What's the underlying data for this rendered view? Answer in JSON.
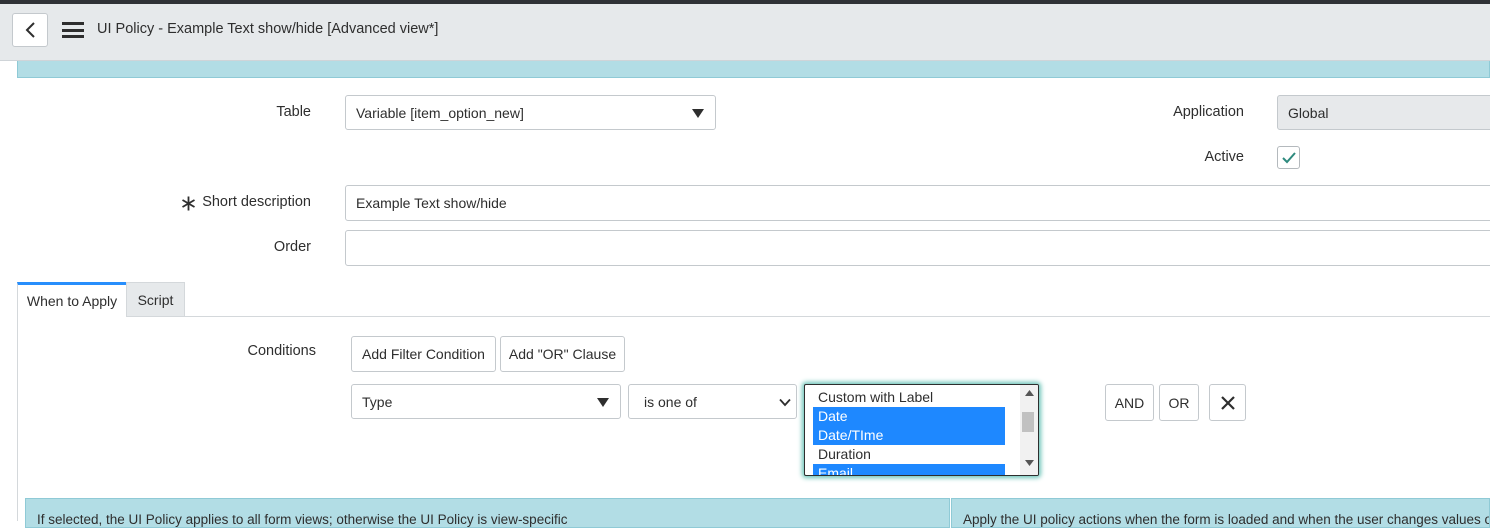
{
  "header": {
    "title": "UI Policy - Example Text show/hide",
    "view": "[Advanced view*]"
  },
  "form": {
    "table": {
      "label": "Table",
      "value": "Variable [item_option_new]"
    },
    "application": {
      "label": "Application",
      "value": "Global"
    },
    "active": {
      "label": "Active",
      "checked": true
    },
    "short_description": {
      "label": "Short description",
      "value": "Example Text show/hide",
      "required": true
    },
    "order": {
      "label": "Order",
      "value": ""
    }
  },
  "tabs": [
    {
      "label": "When to Apply",
      "active": true
    },
    {
      "label": "Script",
      "active": false
    }
  ],
  "conditions": {
    "label": "Conditions",
    "add_filter_label": "Add Filter Condition",
    "add_or_label": "Add \"OR\" Clause",
    "field_value": "Type",
    "operator_value": "is one of",
    "options": [
      {
        "label": "Custom with Label",
        "selected": false
      },
      {
        "label": "Date",
        "selected": true
      },
      {
        "label": "Date/TIme",
        "selected": true
      },
      {
        "label": "Duration",
        "selected": false
      },
      {
        "label": "Email",
        "selected": true
      }
    ],
    "and_label": "AND",
    "or_label": "OR"
  },
  "info": {
    "left": "If selected, the UI Policy applies to all form views; otherwise the UI Policy is view-specific",
    "right": "Apply the UI policy actions when the form is loaded and when the user changes values o"
  },
  "colors": {
    "accent": "#278efc",
    "selection": "#1e88ff",
    "info_bg": "#b2dde5",
    "check": "#2e8a7e"
  }
}
